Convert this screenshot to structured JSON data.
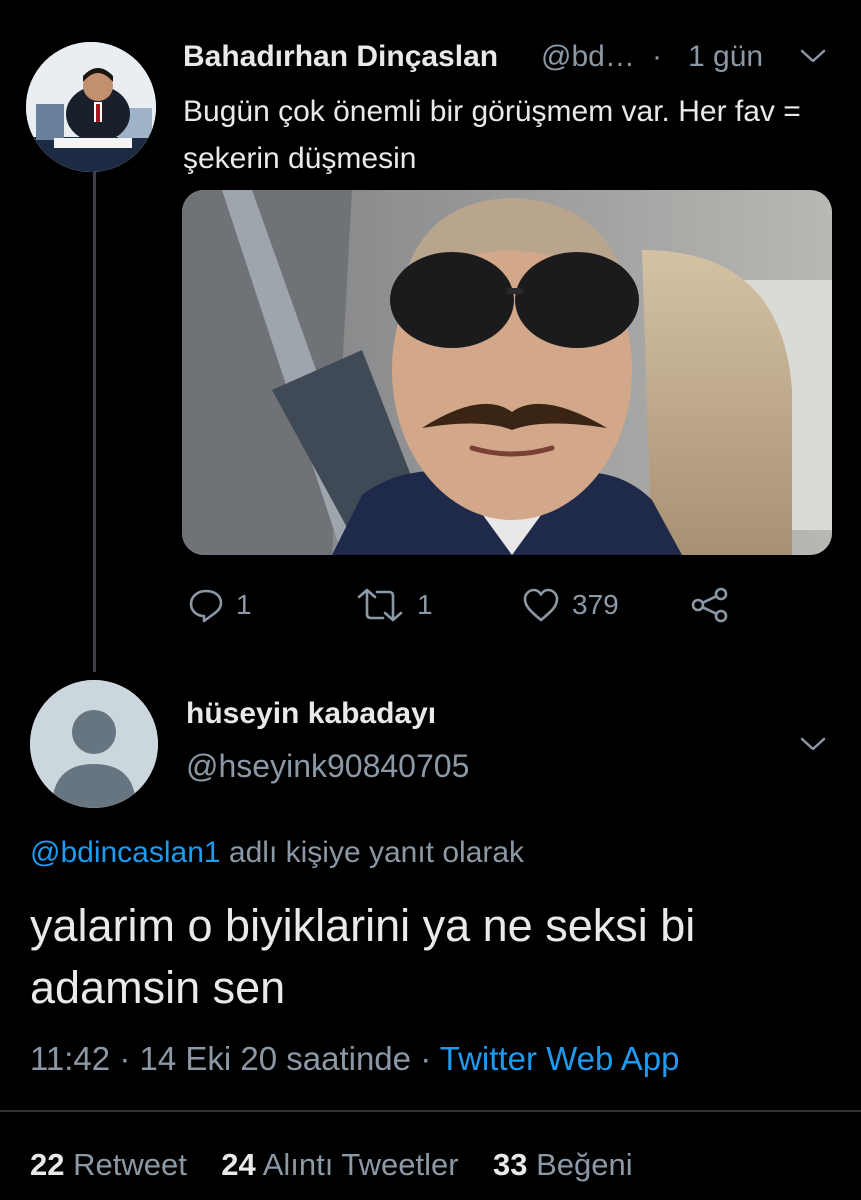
{
  "parent_tweet": {
    "author_name": "Bahadırhan Dinçaslan",
    "author_handle": "@bd…",
    "separator": "·",
    "time": "1 gün",
    "text": "Bugün çok önemli bir görüşmem var. Her fav = şekerin düşmesin",
    "reply_count": "1",
    "retweet_count": "1",
    "like_count": "379"
  },
  "reply_tweet": {
    "author_name": "hüseyin kabadayı",
    "author_handle": "@hseyink90840705",
    "reply_to_mention": "@bdincaslan1",
    "reply_to_suffix": "adlı kişiye yanıt olarak",
    "text": "yalarim o biyiklarini ya ne seksi bi adamsin sen",
    "time": "11:42",
    "date": "14 Eki 20 saatinde",
    "dot": "·",
    "source": "Twitter Web App",
    "stats": {
      "retweets_count": "22",
      "retweets_label": "Retweet",
      "quotes_count": "24",
      "quotes_label": "Alıntı Tweetler",
      "likes_count": "33",
      "likes_label": "Beğeni"
    }
  },
  "icons": [
    "reply-icon",
    "retweet-icon",
    "like-icon",
    "share-icon",
    "chevron-down-icon"
  ],
  "colors": {
    "background": "#000000",
    "accent": "#1d9bf0",
    "muted": "#8b98a5",
    "text": "#e7e9ea"
  }
}
